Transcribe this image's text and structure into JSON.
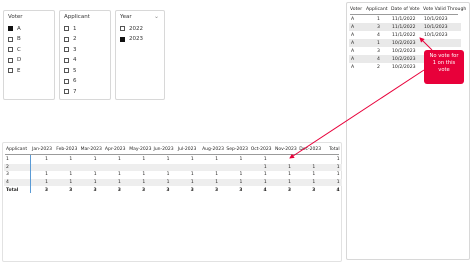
{
  "slicers": {
    "voter": {
      "title": "Voter",
      "items": [
        {
          "label": "A",
          "checked": true
        },
        {
          "label": "B",
          "checked": false
        },
        {
          "label": "C",
          "checked": false
        },
        {
          "label": "D",
          "checked": false
        },
        {
          "label": "E",
          "checked": false
        }
      ]
    },
    "applicant": {
      "title": "Applicant",
      "items": [
        {
          "label": "1",
          "checked": false
        },
        {
          "label": "2",
          "checked": false
        },
        {
          "label": "3",
          "checked": false
        },
        {
          "label": "4",
          "checked": false
        },
        {
          "label": "5",
          "checked": false
        },
        {
          "label": "6",
          "checked": false
        },
        {
          "label": "7",
          "checked": false
        }
      ]
    },
    "year": {
      "title": "Year",
      "chevron_icon": "chevron-down-icon",
      "items": [
        {
          "label": "2022",
          "checked": false
        },
        {
          "label": "2023",
          "checked": true
        }
      ]
    }
  },
  "votes_table": {
    "headers": [
      "Voter",
      "Applicant",
      "Date of Vote",
      "Vote Valid Through"
    ],
    "rows": [
      [
        "A",
        "1",
        "11/1/2022",
        "10/1/2023"
      ],
      [
        "A",
        "3",
        "11/1/2022",
        "10/1/2023"
      ],
      [
        "A",
        "4",
        "11/1/2022",
        "10/1/2023"
      ],
      [
        "A",
        "1",
        "10/2/2023",
        ""
      ],
      [
        "A",
        "3",
        "10/2/2023",
        ""
      ],
      [
        "A",
        "4",
        "10/2/2023",
        ""
      ],
      [
        "A",
        "2",
        "10/2/2023",
        ""
      ]
    ]
  },
  "callout": {
    "lines": [
      "No vote for",
      "1 on this",
      "vote"
    ],
    "color": "#e8003a"
  },
  "matrix": {
    "headers": [
      "Applicant",
      "Jan-2023",
      "Feb-2023",
      "Mar-2023",
      "Apr-2023",
      "May-2023",
      "Jun-2023",
      "Jul-2023",
      "Aug-2023",
      "Sep-2023",
      "Oct-2023",
      "Nov-2023",
      "Dec-2023",
      "Total"
    ],
    "rows": [
      [
        "1",
        "1",
        "1",
        "1",
        "1",
        "1",
        "1",
        "1",
        "1",
        "1",
        "1",
        "",
        "",
        "1"
      ],
      [
        "2",
        "",
        "",
        "",
        "",
        "",
        "",
        "",
        "",
        "",
        "1",
        "1",
        "1",
        "1"
      ],
      [
        "3",
        "1",
        "1",
        "1",
        "1",
        "1",
        "1",
        "1",
        "1",
        "1",
        "1",
        "1",
        "1",
        "1"
      ],
      [
        "4",
        "1",
        "1",
        "1",
        "1",
        "1",
        "1",
        "1",
        "1",
        "1",
        "1",
        "1",
        "1",
        "1"
      ]
    ],
    "total": [
      "Total",
      "3",
      "3",
      "3",
      "3",
      "3",
      "3",
      "3",
      "3",
      "3",
      "4",
      "3",
      "3",
      "4"
    ]
  },
  "arrow_color": "#e8003a"
}
